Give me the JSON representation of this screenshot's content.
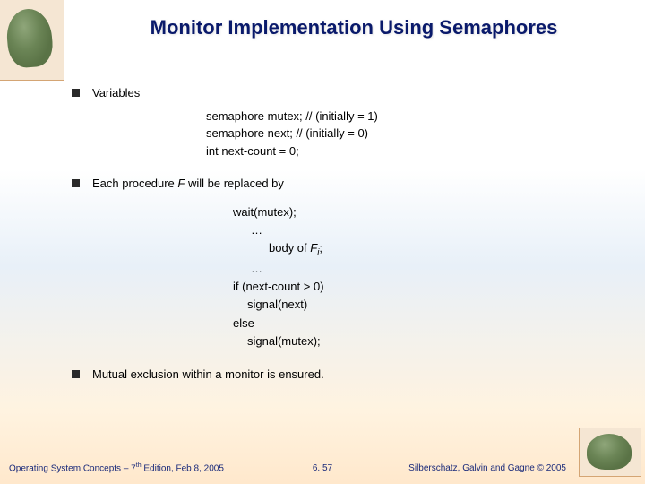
{
  "title": "Monitor Implementation Using Semaphores",
  "bullets": {
    "b1": "Variables",
    "b2_pre": "Each procedure ",
    "b2_var": "F",
    "b2_post": " will be replaced by",
    "b3": "Mutual exclusion within a monitor is ensured."
  },
  "code1": {
    "l1": "semaphore mutex;  // (initially  = 1)",
    "l2": "semaphore next;     // (initially  = 0)",
    "l3": "int next-count = 0;"
  },
  "code2": {
    "l1": "wait(mutex);",
    "l2": "…",
    "l3_pre": "body of ",
    "l3_var": "F",
    "l3_post": ";",
    "l4": "…",
    "l5": "if (next-count > 0)",
    "l6": "signal(next)",
    "l7": "else",
    "l8": "signal(mutex);"
  },
  "footer": {
    "left_pre": "Operating System Concepts – 7",
    "left_sup": "th",
    "left_post": " Edition, Feb 8, 2005",
    "center": "6. 57",
    "right_pre": "Silberschatz, Galvin and Gagne ",
    "right_copy": "©",
    "right_post": " 2005"
  }
}
